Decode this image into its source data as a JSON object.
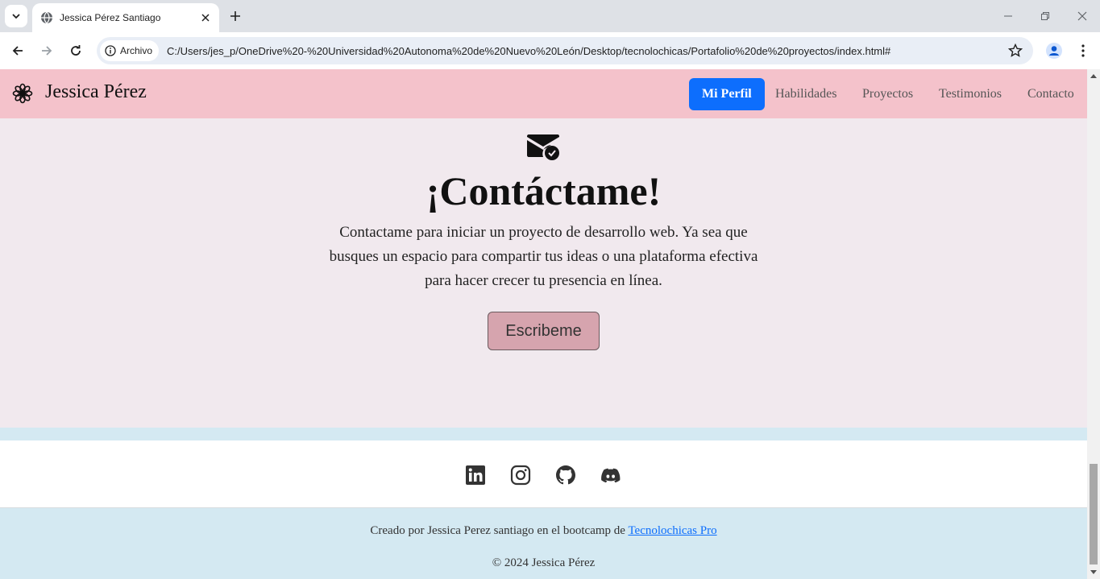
{
  "browser": {
    "tab_title": "Jessica Pérez Santiago",
    "chip_label": "Archivo",
    "url": "C:/Users/jes_p/OneDrive%20-%20Universidad%20Autonoma%20de%20Nuevo%20León/Desktop/tecnolochicas/Portafolio%20de%20proyectos/index.html#"
  },
  "navbar": {
    "brand": "Jessica Pérez",
    "links": [
      "Mi Perfil",
      "Habilidades",
      "Proyectos",
      "Testimonios",
      "Contacto"
    ],
    "active_color": "#0d6efd",
    "background": "#f4c2cb"
  },
  "contact": {
    "title": "¡Contáctame!",
    "text": "Contactame para iniciar un proyecto de desarrollo web. Ya sea que busques un espacio para compartir tus ideas o una plataforma efectiva para hacer crecer tu presencia en línea.",
    "button": "Escribeme",
    "icon": "envelope-check-icon"
  },
  "social": {
    "icons": [
      "linkedin-icon",
      "instagram-icon",
      "github-icon",
      "discord-icon"
    ]
  },
  "footer": {
    "credit_prefix": "Creado por Jessica Perez santiago en el bootcamp de ",
    "credit_link": "Tecnolochicas Pro",
    "copyright": "© 2024 Jessica Pérez"
  }
}
